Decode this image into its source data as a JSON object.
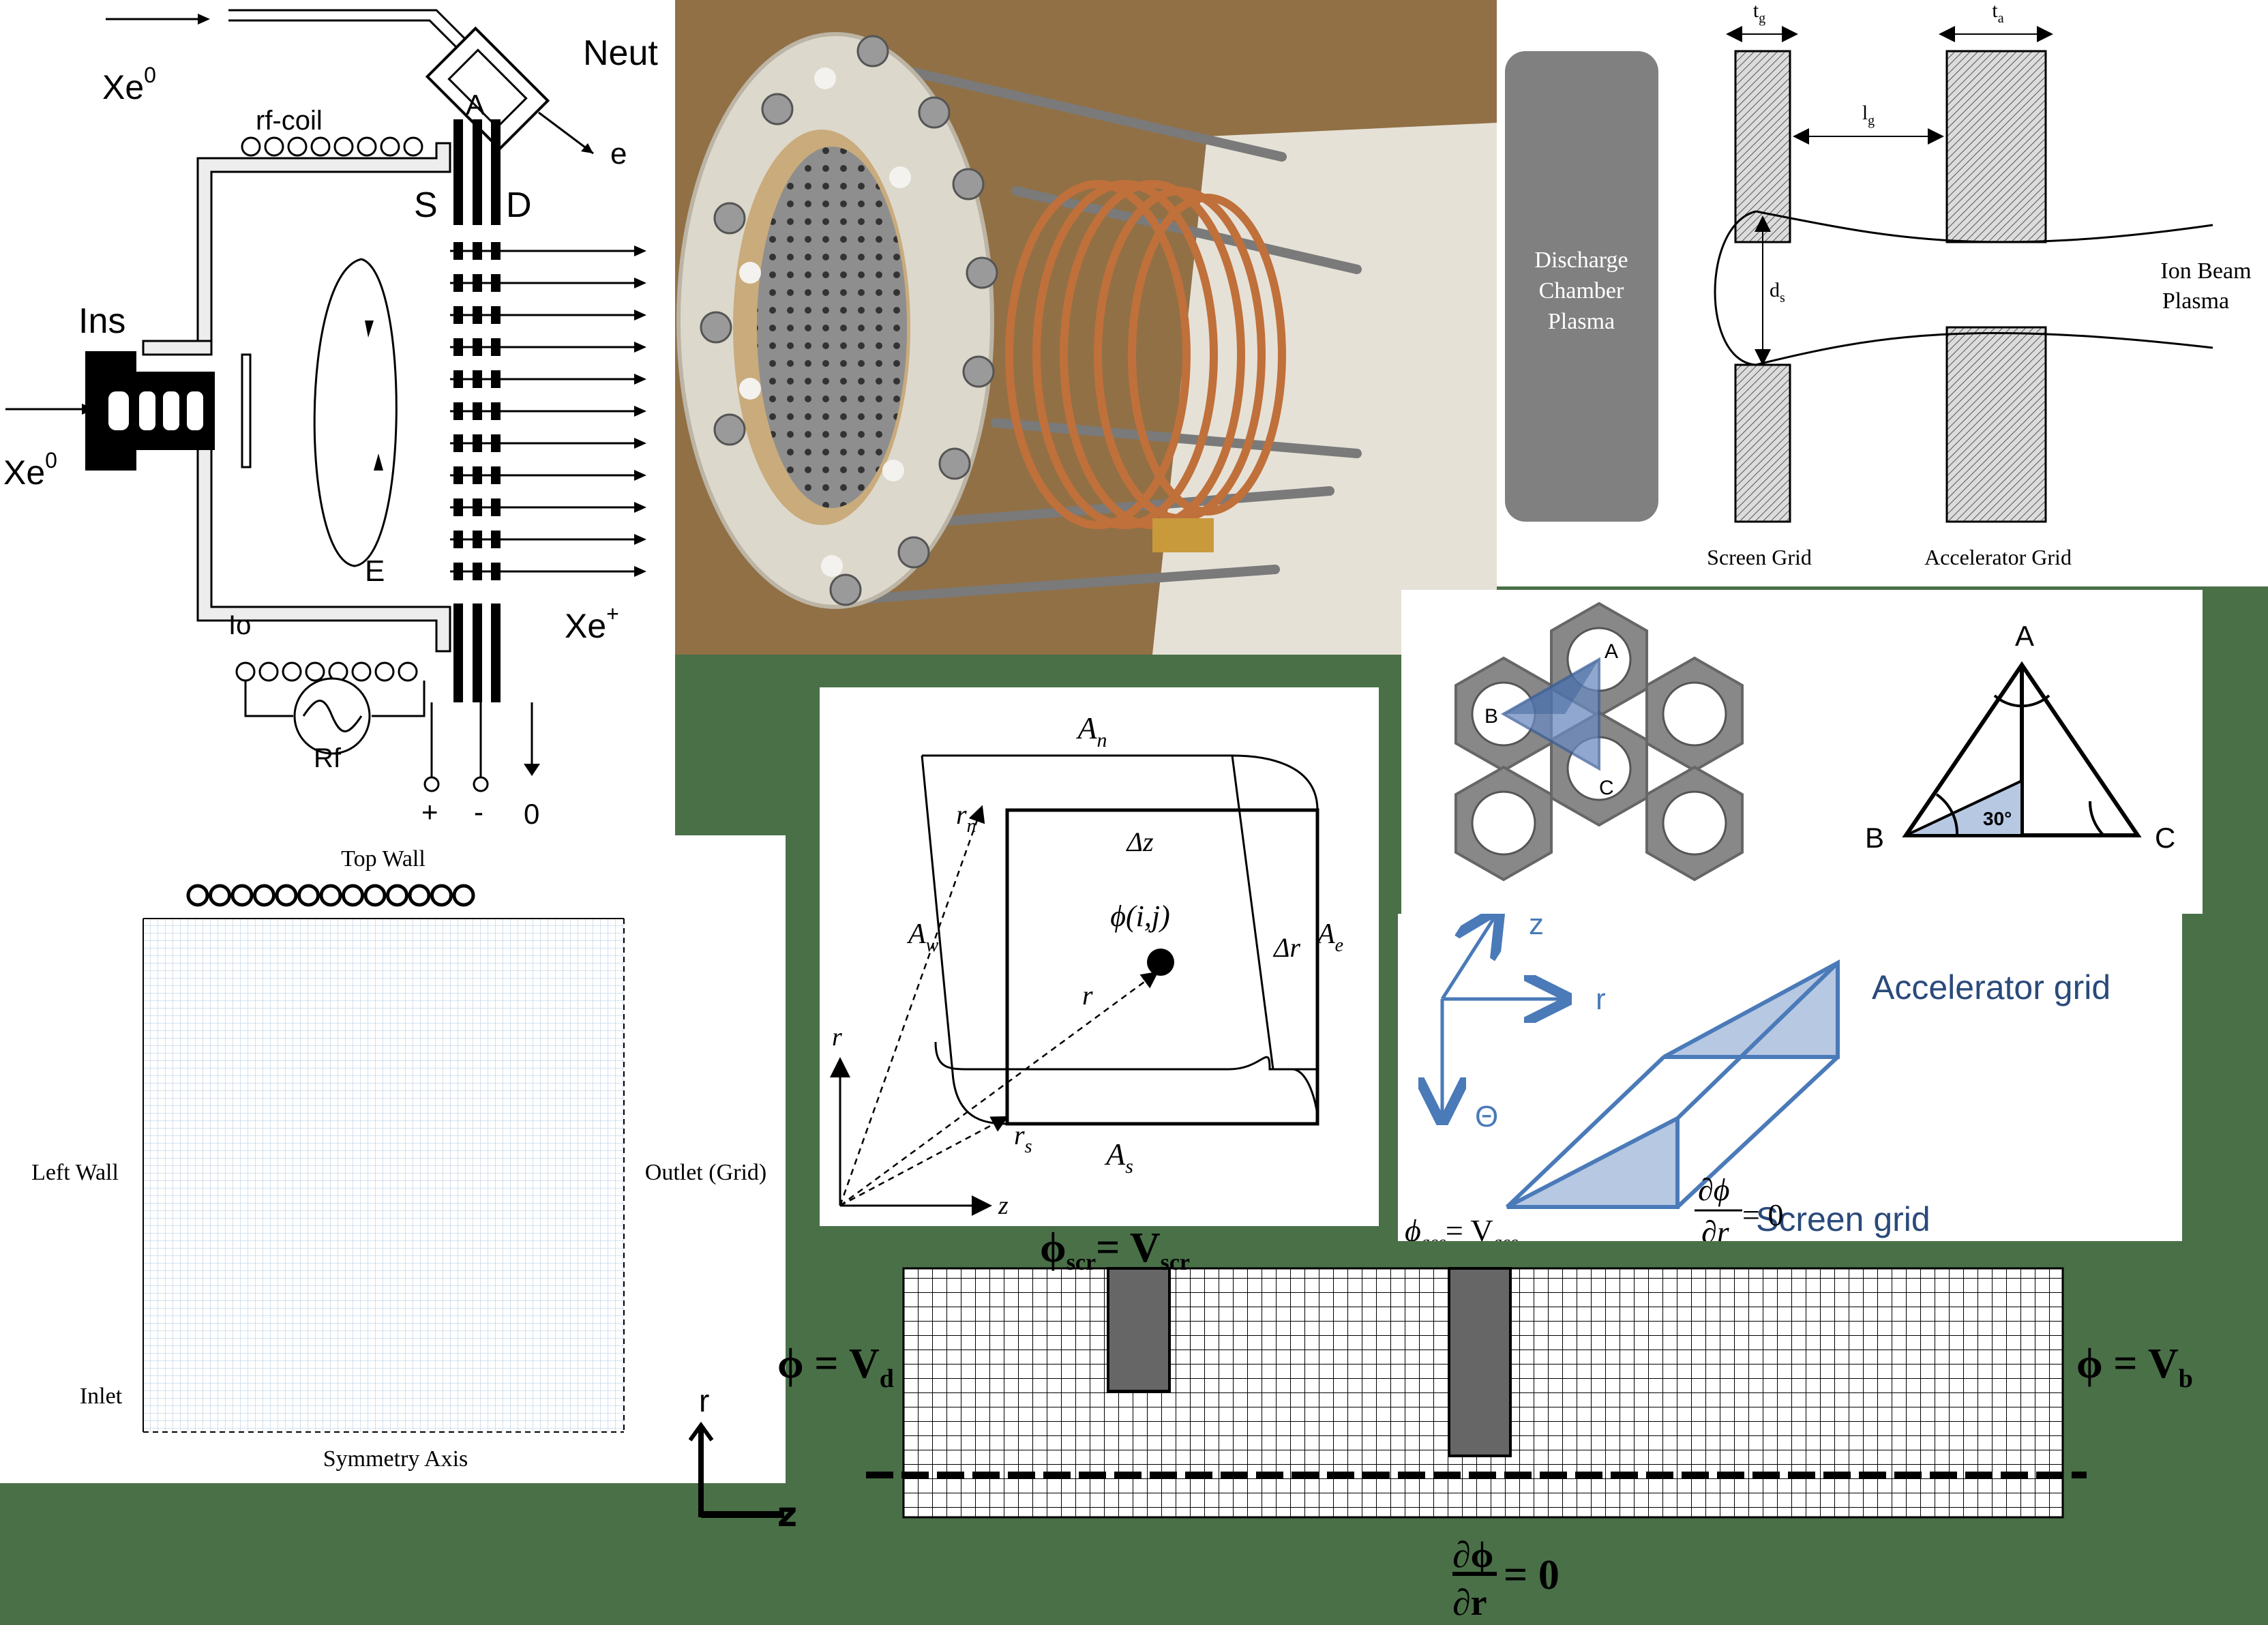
{
  "thruster_schematic": {
    "neut": "Neut",
    "electron": "e",
    "xe0_top": "Xe",
    "xe0_top_sup": "0",
    "rf_coil": "rf-coil",
    "a": "A",
    "s": "S",
    "d": "D",
    "ins": "Ins",
    "xe0_left": "Xe",
    "xe0_left_sup": "0",
    "e_field": "E",
    "io": "Io",
    "xe_plus": "Xe",
    "xe_plus_sup": "+",
    "rf": "Rf",
    "plus": "+",
    "minus": "-",
    "zero": "0"
  },
  "grid_gap_diagram": {
    "tg": "t",
    "tg_sub": "g",
    "ta": "t",
    "ta_sub": "a",
    "lg": "l",
    "lg_sub": "g",
    "ds": "d",
    "ds_sub": "s",
    "discharge_line1": "Discharge",
    "discharge_line2": "Chamber",
    "discharge_line3": "Plasma",
    "ion_beam_line1": "Ion Beam",
    "ion_beam_line2": "Plasma",
    "screen_grid": "Screen Grid",
    "accel_grid": "Accelerator Grid"
  },
  "hex_diagram": {
    "a": "A",
    "b": "B",
    "c": "C",
    "tri_a": "A",
    "tri_b": "B",
    "tri_c": "C",
    "angle": "30°"
  },
  "mesh_domain": {
    "top_wall": "Top Wall",
    "left_wall": "Left Wall",
    "outlet": "Outlet (Grid)",
    "inlet": "Inlet",
    "symmetry_axis": "Symmetry Axis"
  },
  "control_volume": {
    "an": "A",
    "an_sub": "n",
    "as": "A",
    "as_sub": "s",
    "aw": "A",
    "aw_sub": "w",
    "ae": "A",
    "ae_sub": "e",
    "rn": "r",
    "rn_sub": "n",
    "rs": "r",
    "rs_sub": "s",
    "dz": "Δz",
    "dr": "Δr",
    "phi": "ϕ(i,j)",
    "r_vec": "r",
    "r_axis": "r",
    "z_axis": "z"
  },
  "wedge_diagram": {
    "z": "z",
    "r": "r",
    "theta": "Θ",
    "accel_grid": "Accelerator grid",
    "screen_grid": "Screen grid",
    "dphi": "∂ϕ",
    "dr": "∂r",
    "eq_zero": "= 0",
    "phi_ac": "ϕ",
    "phi_ac_sub": "acc",
    "eq_v": "= V",
    "v_sub": "acc"
  },
  "bottom_mesh": {
    "r_axis": "r",
    "z_axis": "z",
    "phi_left": "ϕ = V",
    "phi_left_sub": "d",
    "phi_right": "ϕ = V",
    "phi_right_sub": "b",
    "phi_scr": "ϕ",
    "phi_scr_sub": "scr",
    "eq_vscr": "= V",
    "vscr_sub": "scr",
    "dphi": "∂ϕ",
    "dr": "∂r",
    "eq_zero": "= 0"
  }
}
